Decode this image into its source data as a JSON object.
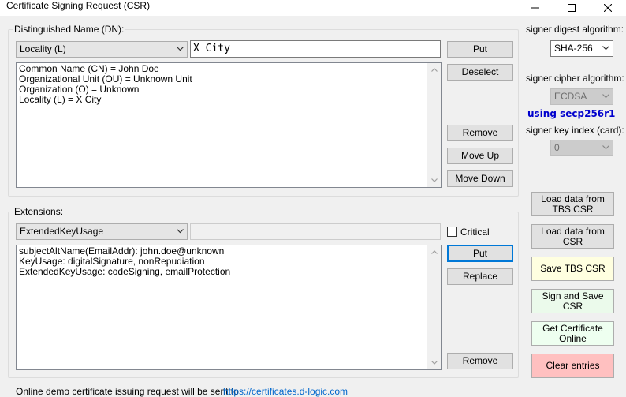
{
  "window": {
    "title": "Certificate Signing Request (CSR)",
    "minimize_icon": "minimize-icon",
    "maximize_icon": "maximize-icon",
    "close_icon": "close-icon"
  },
  "dn_group": {
    "label": "Distinguished Name (DN):",
    "selected_attribute": "Locality (L)",
    "value_input": "X City",
    "entries": [
      "Common Name (CN) = John Doe",
      "Organizational Unit (OU) = Unknown Unit",
      "Organization (O) = Unknown",
      "Locality (L) = X City"
    ],
    "buttons": {
      "put": "Put",
      "deselect": "Deselect",
      "remove": "Remove",
      "move_up": "Move Up",
      "move_down": "Move Down"
    }
  },
  "ext_group": {
    "label": "Extensions:",
    "selected_extension": "ExtendedKeyUsage",
    "value_input": "",
    "critical_label": "Critical",
    "critical_checked": false,
    "entries": [
      "subjectAltName(EmailAddr): john.doe@unknown",
      "KeyUsage: digitalSignature, nonRepudiation",
      "ExtendedKeyUsage: codeSigning, emailProtection"
    ],
    "buttons": {
      "put": "Put",
      "replace": "Replace",
      "remove": "Remove"
    }
  },
  "signer": {
    "digest_label": "signer digest algorithm:",
    "digest_value": "SHA-256",
    "cipher_label": "signer cipher algorithm:",
    "cipher_value": "ECDSA",
    "curve_text": "using secp256r1",
    "key_index_label": "signer key index (card):",
    "key_index_value": "0"
  },
  "actions": {
    "load_tbs": "Load data from TBS CSR",
    "load_csr": "Load data from CSR",
    "save_tbs": "Save TBS CSR",
    "sign_save": "Sign and Save CSR",
    "get_cert": "Get Certificate Online",
    "clear": "Clear entries"
  },
  "footer": {
    "text": "Online demo certificate issuing request will be sent to",
    "link": "https://certificates.d-logic.com"
  },
  "colors": {
    "accent_focus": "#0078d7",
    "curve_text": "#0000cd",
    "link": "#0066cc",
    "save_tbs_bg": "#ffffe0",
    "sign_save_bg": "#ebfaeb",
    "get_cert_bg": "#eefff0",
    "clear_bg": "#ffc0c0"
  }
}
